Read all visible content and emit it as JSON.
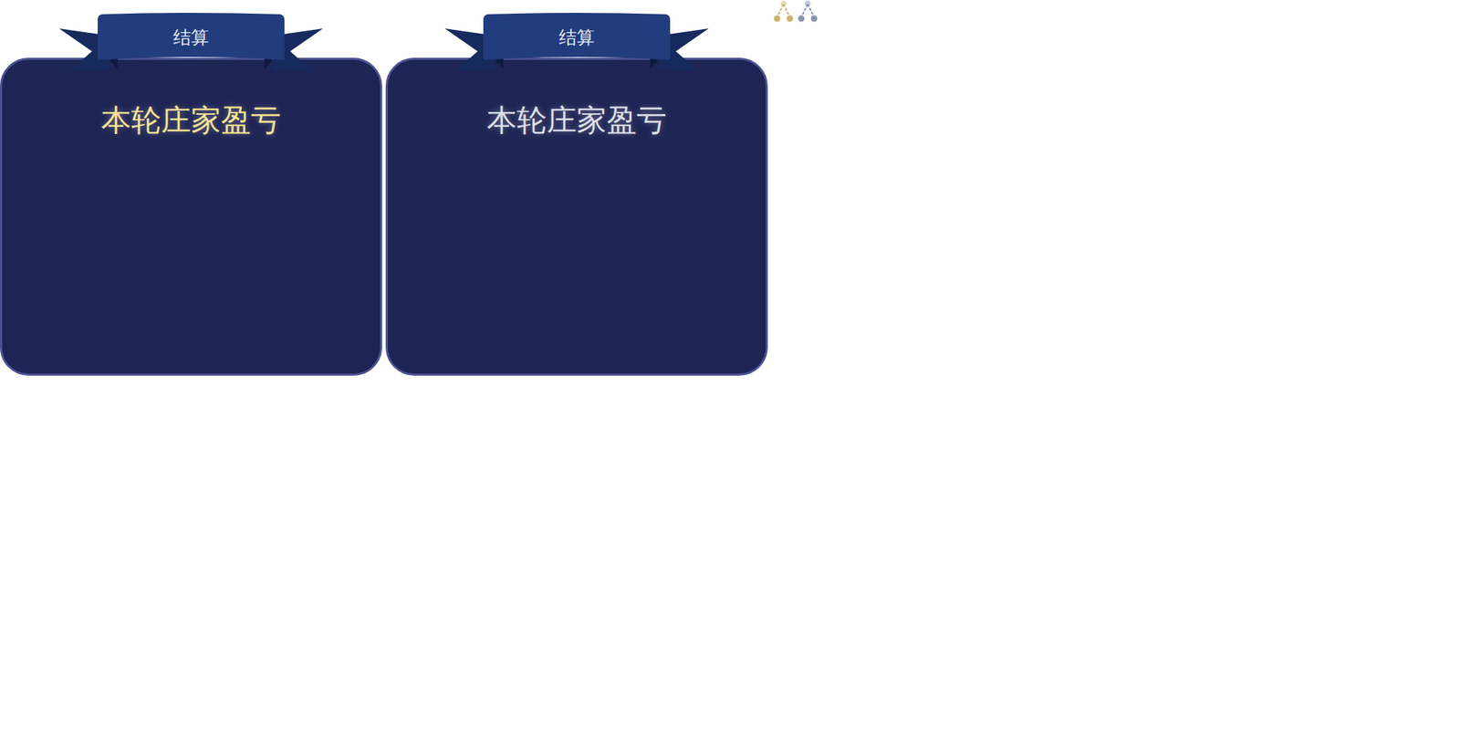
{
  "panels": [
    {
      "banner": "结算",
      "title": "本轮庄家盈亏",
      "color": "#f6e391"
    },
    {
      "banner": "结算",
      "title": "本轮庄家盈亏",
      "color": "#dcdfe8"
    }
  ],
  "icons": [
    {
      "color": "#c9b46a"
    },
    {
      "color": "#8a95ad"
    }
  ]
}
